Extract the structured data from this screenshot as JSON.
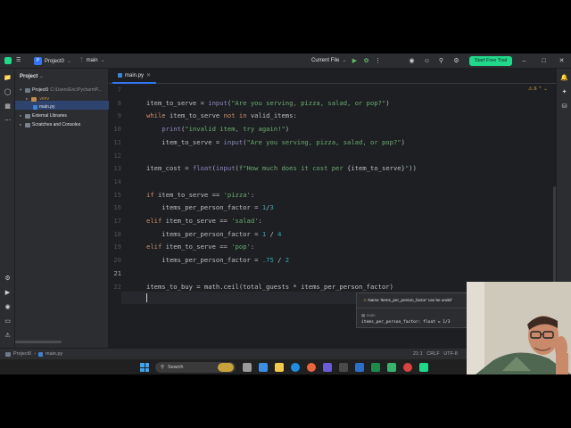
{
  "titlebar": {
    "project_badge": "P",
    "project_name": "Project0",
    "branch": "main",
    "run_config": "Current File",
    "trial_button": "Start Free Trial"
  },
  "project_panel": {
    "title": "Project",
    "tree": [
      {
        "label": "Project0",
        "path": "C:\\Users\\Eric\\PycharmP...",
        "level": 0
      },
      {
        "label": ".venv",
        "level": 1
      },
      {
        "label": "main.py",
        "level": 1
      },
      {
        "label": "External Libraries",
        "level": 0
      },
      {
        "label": "Scratches and Consoles",
        "level": 0
      }
    ]
  },
  "editor": {
    "tab_label": "main.py",
    "inspection_count": "6",
    "cursor_line": 21,
    "lines": [
      {
        "n": "7",
        "tokens": [
          {
            "t": ""
          }
        ]
      },
      {
        "n": "8",
        "tokens": [
          {
            "t": "item_to_serve = "
          },
          {
            "t": "input",
            "c": "b"
          },
          {
            "t": "("
          },
          {
            "t": "\"Are you serving, pizza, salad, or pop?\"",
            "c": "s"
          },
          {
            "t": ")"
          }
        ]
      },
      {
        "n": "9",
        "tokens": [
          {
            "t": "while ",
            "c": "k"
          },
          {
            "t": "item_to_serve "
          },
          {
            "t": "not in ",
            "c": "k"
          },
          {
            "t": "valid_items:"
          }
        ]
      },
      {
        "n": "10",
        "tokens": [
          {
            "t": "    "
          },
          {
            "t": "print",
            "c": "b"
          },
          {
            "t": "("
          },
          {
            "t": "\"invalid item, try again!\"",
            "c": "s"
          },
          {
            "t": ")"
          }
        ]
      },
      {
        "n": "11",
        "tokens": [
          {
            "t": "    item_to_serve = "
          },
          {
            "t": "input",
            "c": "b"
          },
          {
            "t": "("
          },
          {
            "t": "\"Are you serving, pizza, salad, or pop?\"",
            "c": "s"
          },
          {
            "t": ")"
          }
        ]
      },
      {
        "n": "12",
        "tokens": [
          {
            "t": ""
          }
        ]
      },
      {
        "n": "13",
        "tokens": [
          {
            "t": "item_cost = "
          },
          {
            "t": "float",
            "c": "b"
          },
          {
            "t": "("
          },
          {
            "t": "input",
            "c": "b"
          },
          {
            "t": "("
          },
          {
            "t": "f\"How much does it cost per ",
            "c": "s"
          },
          {
            "t": "{item_to_serve}"
          },
          {
            "t": "\"",
            "c": "s"
          },
          {
            "t": "))"
          }
        ]
      },
      {
        "n": "14",
        "tokens": [
          {
            "t": ""
          }
        ]
      },
      {
        "n": "15",
        "tokens": [
          {
            "t": "if ",
            "c": "k"
          },
          {
            "t": "item_to_serve == "
          },
          {
            "t": "'pizza'",
            "c": "s"
          },
          {
            "t": ":"
          }
        ]
      },
      {
        "n": "16",
        "tokens": [
          {
            "t": "    items_per_person_factor = "
          },
          {
            "t": "1",
            "c": "n"
          },
          {
            "t": "/"
          },
          {
            "t": "3",
            "c": "n"
          }
        ]
      },
      {
        "n": "17",
        "tokens": [
          {
            "t": "elif ",
            "c": "k"
          },
          {
            "t": "item_to_serve == "
          },
          {
            "t": "'salad'",
            "c": "s"
          },
          {
            "t": ":"
          }
        ]
      },
      {
        "n": "18",
        "tokens": [
          {
            "t": "    items_per_person_factor = "
          },
          {
            "t": "1",
            "c": "n"
          },
          {
            "t": " / "
          },
          {
            "t": "4",
            "c": "n"
          }
        ]
      },
      {
        "n": "19",
        "tokens": [
          {
            "t": "elif ",
            "c": "k"
          },
          {
            "t": "item_to_serve == "
          },
          {
            "t": "'pop'",
            "c": "s"
          },
          {
            "t": ":"
          }
        ]
      },
      {
        "n": "20",
        "tokens": [
          {
            "t": "    items_per_person_factor = "
          },
          {
            "t": ".75",
            "c": "n"
          },
          {
            "t": " / "
          },
          {
            "t": "2",
            "c": "n"
          }
        ]
      },
      {
        "n": "21",
        "tokens": [
          {
            "t": ""
          }
        ]
      },
      {
        "n": "22",
        "tokens": [
          {
            "t": "items_to_buy = math.ceil(total_guests * items_per_person_factor)"
          }
        ]
      }
    ]
  },
  "popup": {
    "message": "Name 'items_per_person_factor' can be undef",
    "location": "main",
    "signature": "items_per_person_factor: float = 1/3"
  },
  "statusbar": {
    "breadcrumb_project": "Project0",
    "breadcrumb_file": "main.py",
    "position": "21:1",
    "line_ending": "CRLF",
    "encoding": "UTF-8"
  },
  "taskbar": {
    "search_label": "Search"
  },
  "colors": {
    "keyword": "#cf8e6d",
    "string": "#6aab73",
    "number": "#2aacb8",
    "builtin": "#8888c6",
    "accent": "#3574f0",
    "trial": "#21d789"
  }
}
